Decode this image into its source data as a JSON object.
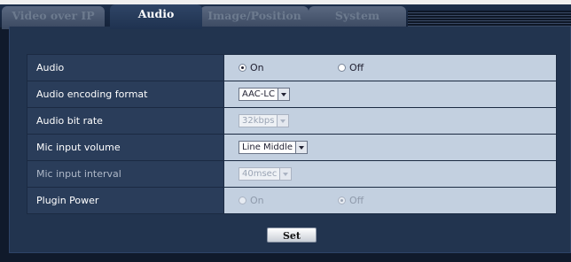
{
  "tabs": [
    {
      "label": "Video over IP",
      "active": false
    },
    {
      "label": "Audio",
      "active": true
    },
    {
      "label": "Image/Position",
      "active": false
    },
    {
      "label": "System",
      "active": false
    }
  ],
  "settings": {
    "audio": {
      "label": "Audio",
      "options": [
        "On",
        "Off"
      ],
      "selected": "On"
    },
    "encoding": {
      "label": "Audio encoding format",
      "value": "AAC-LC"
    },
    "bitrate": {
      "label": "Audio bit rate",
      "value": "32kbps",
      "disabled": true
    },
    "mic_volume": {
      "label": "Mic input volume",
      "value": "Line Middle"
    },
    "mic_interval": {
      "label": "Mic input interval",
      "value": "40msec",
      "disabled": true
    },
    "plugin_power": {
      "label": "Plugin Power",
      "options": [
        "On",
        "Off"
      ],
      "selected": "Off",
      "disabled": true
    }
  },
  "set_button": "Set",
  "colors": {
    "panel": "#22344f",
    "label_cell": "#2a3d5a",
    "value_cell": "#c3d0e0",
    "background": "#101a2b"
  }
}
